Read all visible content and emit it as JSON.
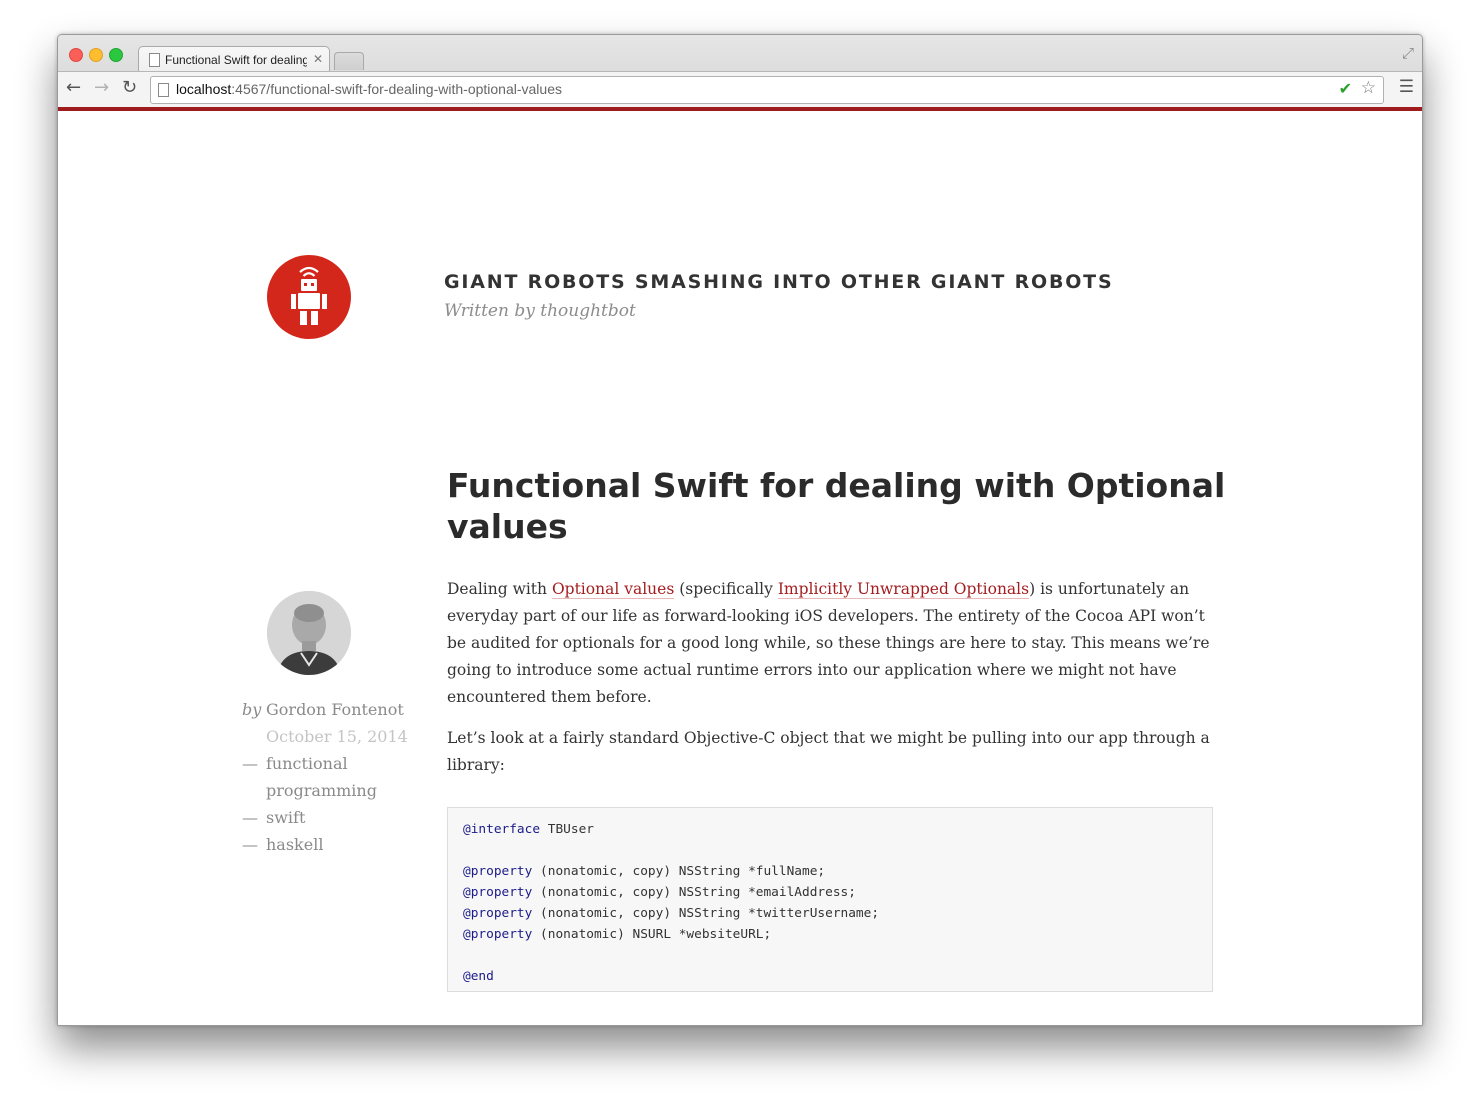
{
  "browser": {
    "tab": {
      "title": "Functional Swift for dealing with Optional values"
    },
    "url": {
      "host": "localhost",
      "rest": ":4567/functional-swift-for-dealing-with-optional-values"
    }
  },
  "icons": {
    "back": "back-arrow-icon",
    "forward": "forward-arrow-icon",
    "reload": "reload-icon",
    "star": "star-icon",
    "menu": "menu-icon",
    "extension": "checkmark-extension-icon",
    "fullscreen": "fullscreen-icon",
    "close": "close-icon"
  },
  "colors": {
    "accent": "#9e1c1e",
    "logo": "#d3271c",
    "link": "#a51d1f"
  },
  "header": {
    "title": "GIANT ROBOTS SMASHING INTO OTHER GIANT ROBOTS",
    "byline_prefix": "Written by ",
    "byline_author": "thoughtbot"
  },
  "post": {
    "title": "Functional Swift for dealing with Optional values",
    "author_prefix": "by",
    "author": "Gordon Fontenot",
    "date": "October 15, 2014",
    "tag_prefix": "—",
    "tags": [
      {
        "line1": "functional",
        "line2": "programming"
      },
      {
        "line1": "swift"
      },
      {
        "line1": "haskell"
      }
    ],
    "p1": {
      "before": "Dealing with ",
      "link1": "Optional values",
      "middle": " (specifically ",
      "link2": "Implicitly Unwrapped Optionals",
      "after": ") is unfortunately an everyday part of our life as forward-looking iOS developers. The entirety of the Cocoa API won’t be audited for optionals for a good long while, so these things are here to stay. This means we’re going to introduce some actual runtime errors into our application where we might not have encountered them before."
    },
    "p2": "Let’s look at a fairly standard Objective-C object that we might be pulling into our app through a library:",
    "code": {
      "line1": {
        "kw": "@interface",
        "rest": " TBUser"
      },
      "line3": {
        "kw": "@property",
        "rest": " (nonatomic, copy) NSString *fullName;"
      },
      "line4": {
        "kw": "@property",
        "rest": " (nonatomic, copy) NSString *emailAddress;"
      },
      "line5": {
        "kw": "@property",
        "rest": " (nonatomic, copy) NSString *twitterUsername;"
      },
      "line6": {
        "kw": "@property",
        "rest": " (nonatomic) NSURL *websiteURL;"
      },
      "line8": {
        "kw": "@end",
        "rest": ""
      }
    }
  }
}
